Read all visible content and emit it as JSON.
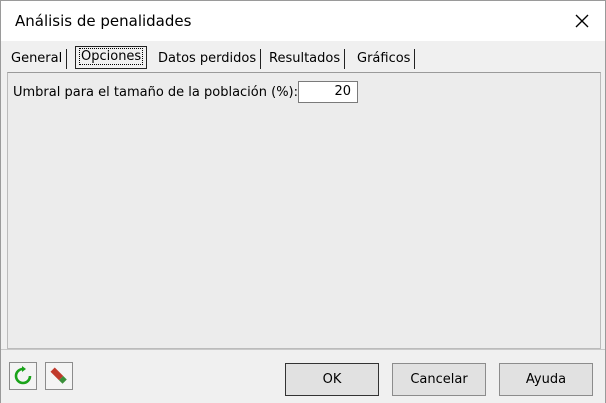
{
  "window": {
    "title": "Análisis de penalidades",
    "close_icon": "close-icon"
  },
  "tabs": [
    {
      "label": "General"
    },
    {
      "label": "Opciones"
    },
    {
      "label": "Datos perdidos"
    },
    {
      "label": "Resultados"
    },
    {
      "label": "Gráficos"
    }
  ],
  "active_tab": "Opciones",
  "options": {
    "threshold_label": "Umbral para el tamaño de la población (%):",
    "threshold_value": "20"
  },
  "footer": {
    "reset_icon": "reset-icon",
    "clear_icon": "eraser-icon",
    "ok_label": "OK",
    "cancel_label": "Cancelar",
    "help_label": "Ayuda"
  },
  "colors": {
    "reset_green": "#1aa31a",
    "eraser_red": "#c0392b",
    "eraser_green": "#3a8f3a"
  }
}
